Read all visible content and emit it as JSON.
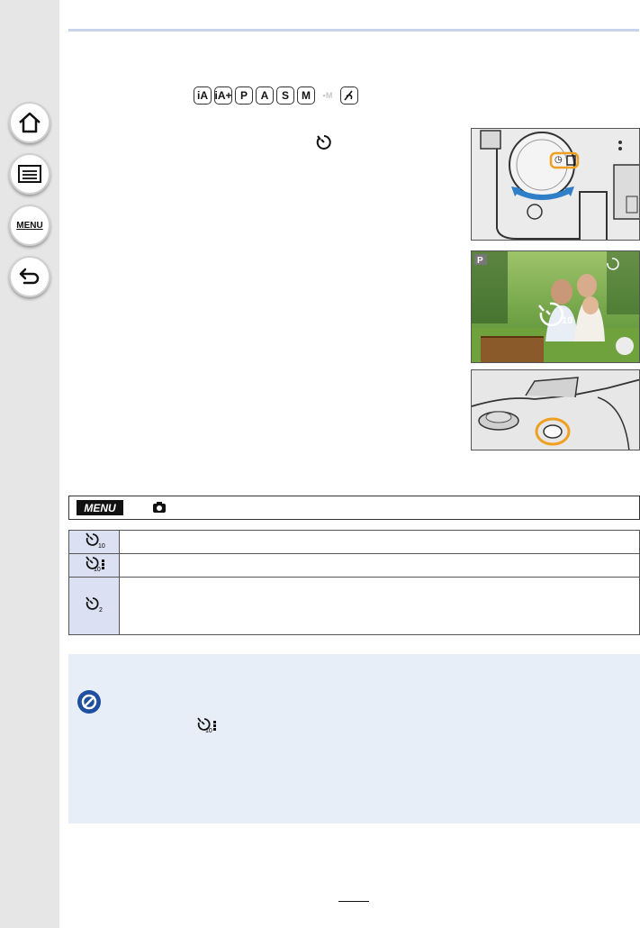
{
  "sidebar": {
    "items": [
      {
        "name": "home",
        "icon": "home-icon"
      },
      {
        "name": "contents",
        "icon": "list-icon"
      },
      {
        "name": "menu",
        "icon": "menu-icon",
        "label": "MENU"
      },
      {
        "name": "back",
        "icon": "return-icon"
      }
    ]
  },
  "modes": {
    "items": [
      "iA",
      "iA+",
      "P",
      "A",
      "S",
      "M",
      "▪M",
      "C"
    ]
  },
  "menu_bar": {
    "badge": "MENU"
  },
  "options": {
    "rows": [
      {
        "icon": "self-timer-10s-icon",
        "sub": "10"
      },
      {
        "icon": "self-timer-10s-3-pictures-icon",
        "sub": "10"
      },
      {
        "icon": "self-timer-2s-icon",
        "sub": "2"
      }
    ]
  },
  "images": {
    "dial_callout": "self-timer dial position",
    "lcd_badge": "P",
    "lcd_countdown": "10"
  },
  "colors": {
    "accent_orange": "#f0a020",
    "rule_blue": "#c8d3ea",
    "note_bg": "#e8eef8",
    "table_icon_bg": "#dbe1f2",
    "note_icon_blue": "#1f4f9f",
    "arrow_blue": "#2f7fc8"
  }
}
